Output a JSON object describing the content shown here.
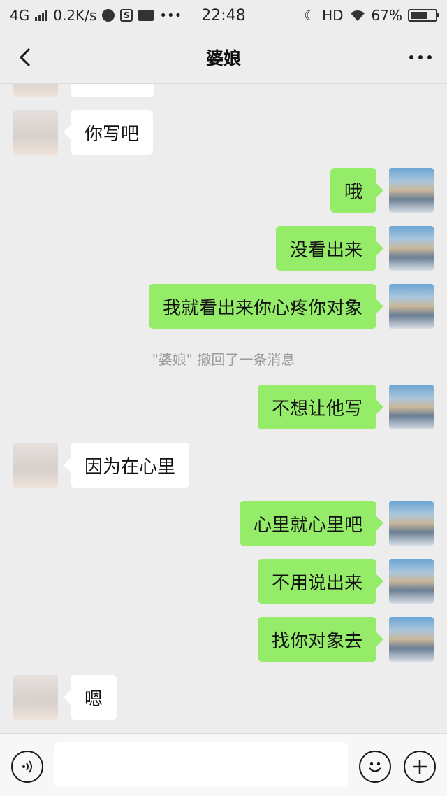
{
  "status_bar": {
    "network": "4G",
    "speed": "0.2K/s",
    "time": "22:48",
    "hd": "HD",
    "battery_pct": "67%",
    "battery_level": 0.67
  },
  "header": {
    "title": "婆娘"
  },
  "messages": [
    {
      "side": "left",
      "text": "你写吧"
    },
    {
      "side": "right",
      "text": "哦"
    },
    {
      "side": "right",
      "text": "没看出来"
    },
    {
      "side": "right",
      "text": "我就看出来你心疼你对象"
    },
    {
      "side": "system",
      "text": "\"婆娘\" 撤回了一条消息"
    },
    {
      "side": "right",
      "text": "不想让他写"
    },
    {
      "side": "left",
      "text": "因为在心里"
    },
    {
      "side": "right",
      "text": "心里就心里吧"
    },
    {
      "side": "right",
      "text": "不用说出来"
    },
    {
      "side": "right",
      "text": "找你对象去"
    },
    {
      "side": "left",
      "text": "嗯"
    }
  ],
  "input": {
    "value": "",
    "placeholder": ""
  },
  "icons": {
    "back": "chevron-left-icon",
    "more": "more-dots-icon",
    "voice": "voice-icon",
    "emoji": "emoji-icon",
    "add": "plus-icon"
  },
  "colors": {
    "background": "#ededed",
    "my_bubble": "#95ec69",
    "their_bubble": "#ffffff",
    "system_text": "#9b9b9b"
  }
}
